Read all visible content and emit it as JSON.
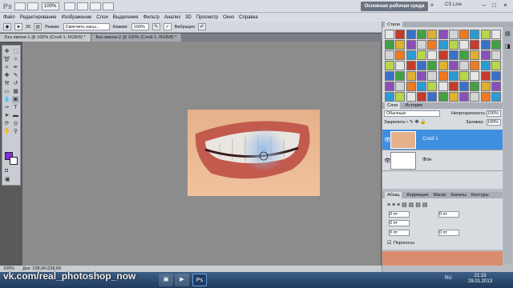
{
  "app": {
    "logo": "Ps",
    "zoom": "100%",
    "workspace": "Основная рабочая среда",
    "cs_live": "CS Live",
    "win_min": "–",
    "win_max": "□",
    "win_close": "×"
  },
  "menu": [
    "Файл",
    "Редактирование",
    "Изображение",
    "Слои",
    "Выделение",
    "Фильтр",
    "Анализ",
    "3D",
    "Просмотр",
    "Окно",
    "Справка"
  ],
  "options": {
    "mode_label": "Режим:",
    "mode_value": "Смягчить насы...",
    "pressure_label": "Нажим:",
    "pressure_value": "100%",
    "vibrance_label": "Вибрация",
    "brush_size": "26"
  },
  "tabs": [
    {
      "label": "Без имени-1 @ 100% (Слой 1, RGB/8) *"
    },
    {
      "label": "Без имени-2 @ 100% (Слой 1, RGB/8) *"
    }
  ],
  "status": {
    "zoom": "100%",
    "doc": "Док: 238,6K/238,6K"
  },
  "panels": {
    "styles_tab": "Стили",
    "layers_tabs": [
      "Слои",
      "История"
    ],
    "blend_mode": "Обычные",
    "opacity_label": "Непрозрачность:",
    "opacity_value": "100%",
    "lock_label": "Закрепить:",
    "fill_label": "Заливка:",
    "fill_value": "100%",
    "layers": [
      {
        "name": "Слой 1"
      },
      {
        "name": "Фон"
      }
    ],
    "paragraph_tabs": [
      "Абзац",
      "Коррекция",
      "Маски",
      "Каналы",
      "Контуры"
    ],
    "indent_values": [
      "0 пт",
      "0 пт",
      "0 пт",
      "0 пт",
      "0 пт"
    ],
    "hyphenation": "Переносы"
  },
  "taskbar": {
    "watermark": "vk.com/real_photoshop_now",
    "lang": "RU",
    "time": "21:19",
    "date": "29.01.2013",
    "ps_label": "Ps"
  },
  "colors": {
    "foreground": "#8a2be2",
    "background": "#ffffff",
    "selected_layer": "#3f8fe0"
  }
}
